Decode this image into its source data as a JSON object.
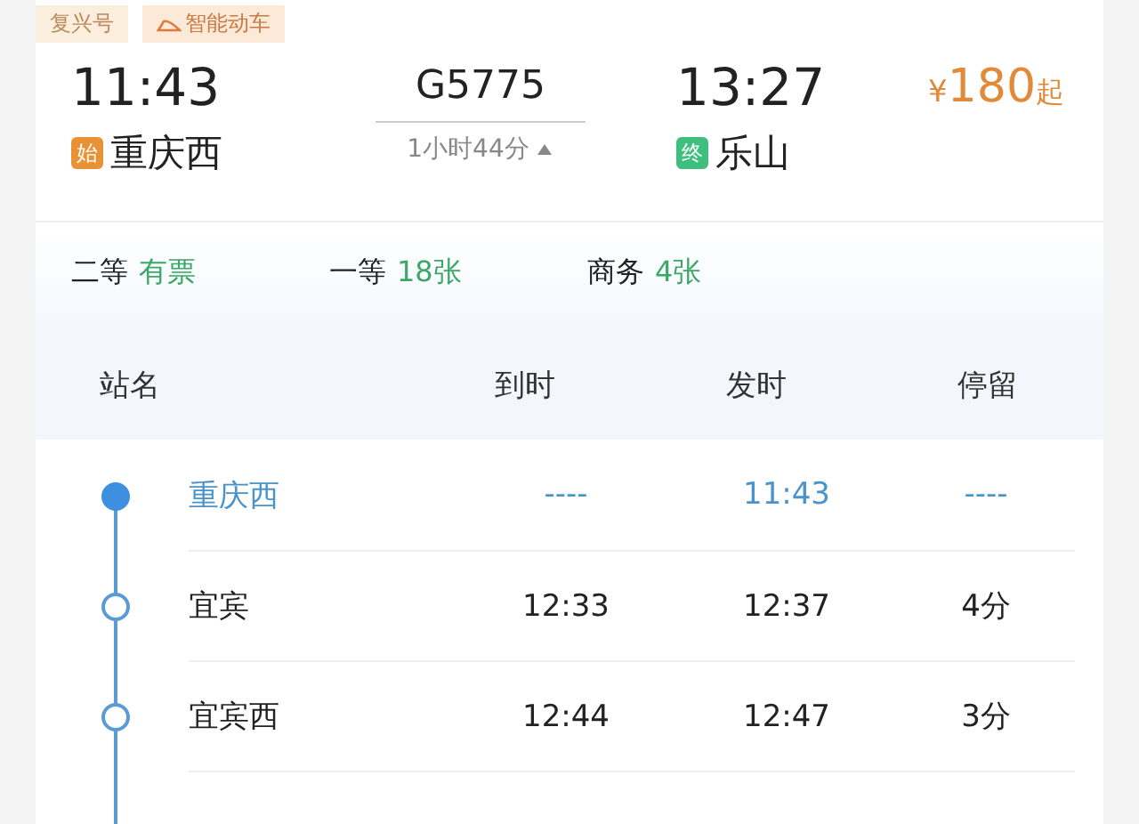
{
  "tags": [
    {
      "label": "复兴号",
      "kind": "plain"
    },
    {
      "label": "智能动车",
      "kind": "smart"
    }
  ],
  "departure": {
    "time": "11:43",
    "badge": "始",
    "station": "重庆西"
  },
  "train": {
    "number": "G5775",
    "duration": "1小时44分",
    "expanded": true
  },
  "arrival": {
    "time": "13:27",
    "badge": "终",
    "station": "乐山"
  },
  "price": {
    "currency": "¥",
    "amount": "180",
    "suffix": "起"
  },
  "seats": [
    {
      "class": "二等",
      "availability": "有票"
    },
    {
      "class": "一等",
      "availability": "18张"
    },
    {
      "class": "商务",
      "availability": "4张"
    }
  ],
  "table": {
    "columns": [
      "站名",
      "到时",
      "发时",
      "停留"
    ],
    "rows": [
      {
        "station": "重庆西",
        "arrive": "----",
        "depart": "11:43",
        "stop": "----",
        "terminal": true
      },
      {
        "station": "宜宾",
        "arrive": "12:33",
        "depart": "12:37",
        "stop": "4分",
        "terminal": false
      },
      {
        "station": "宜宾西",
        "arrive": "12:44",
        "depart": "12:47",
        "stop": "3分",
        "terminal": false
      }
    ]
  }
}
